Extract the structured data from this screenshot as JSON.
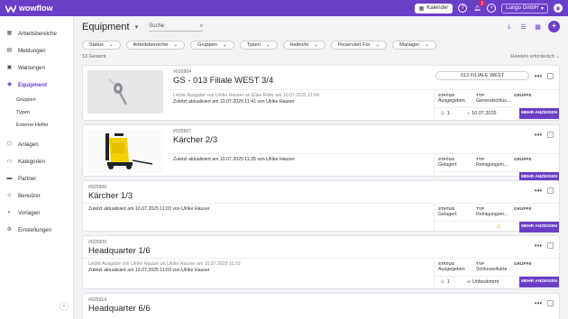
{
  "app": {
    "name": "wowflow"
  },
  "topbar": {
    "calendar_label": "Kalender",
    "notification_count": "1",
    "user_label": "Lungo GmbH"
  },
  "sidebar": {
    "items": [
      {
        "label": "Arbeitsbereiche",
        "icon": "grid-icon"
      },
      {
        "label": "Meldungen",
        "icon": "inbox-icon"
      },
      {
        "label": "Wartungen",
        "icon": "calendar-icon"
      },
      {
        "label": "Equipment",
        "icon": "equipment-icon",
        "active": true
      },
      {
        "label": "Anlagen",
        "icon": "cube-icon"
      },
      {
        "label": "Kategorien",
        "icon": "folder-icon"
      },
      {
        "label": "Partner",
        "icon": "briefcase-icon"
      },
      {
        "label": "Benutzer",
        "icon": "user-icon"
      },
      {
        "label": "Vorlagen",
        "icon": "template-icon"
      },
      {
        "label": "Einstellungen",
        "icon": "gear-icon"
      }
    ],
    "subitems": [
      "Gruppen",
      "Typen",
      "Externe Helfer"
    ]
  },
  "header": {
    "title": "Equipment",
    "search_placeholder": "Suche"
  },
  "filters": [
    "Status",
    "Arbeitsbereiche",
    "Gruppen",
    "Typen",
    "Halter/in",
    "Reserviert Für",
    "Manager"
  ],
  "count_label": "13 Gesamt",
  "sort_label": "Handeln erforderlich",
  "labels": {
    "status": "STATUS",
    "typ": "TYP",
    "gruppe": "GRUPPE",
    "more": "MEHR ANZEIGEN"
  },
  "cards": [
    {
      "id": "#025904",
      "title": "GS - 013 Filiale WEST 3/4",
      "location": "013 FILIALE WEST",
      "note1": "Letzte Ausgabe von Ulrike Hauser an Elias Elder am 10.07.2025 11:04",
      "note2": "Zuletzt aktualisiert am 10.07.2025 11:41 von Ulrike Hauser",
      "status": "Ausgegeben",
      "typ": "Generalschlüs...",
      "gruppe": "",
      "count": "1",
      "date": "10.07.2025",
      "image": "key"
    },
    {
      "id": "#025907",
      "title": "Kärcher 2/3",
      "location": "",
      "note1": "",
      "note2": "Zuletzt aktualisiert am 10.07.2025 11:35 von Ulrike Hauser",
      "status": "Gelagert",
      "typ": "Reinigungsm...",
      "gruppe": "",
      "count": "",
      "date": "",
      "image": "washer"
    },
    {
      "id": "#025906",
      "title": "Kärcher 1/3",
      "location": "",
      "note1": "",
      "note2": "Zuletzt aktualisiert am 10.07.2025 11:03 von Ulrike Hauser",
      "status": "Gelagert",
      "typ": "Reinigungsm...",
      "gruppe": "",
      "count": "",
      "date": "",
      "image": ""
    },
    {
      "id": "#025909",
      "title": "Headquarter 1/6",
      "location": "",
      "note1": "Letzte Ausgabe von Ulrike Hauser an Ulrike Hauser am 10.07.2025 11:03",
      "note2": "Zuletzt aktualisiert am 10.07.2025 11:03 von Ulrike Hauser",
      "status": "Ausgegeben",
      "typ": "Schlüsselkarte",
      "gruppe": "",
      "count": "1",
      "date": "Unbestimmt",
      "image": ""
    },
    {
      "id": "#025914",
      "title": "Headquarter 6/6",
      "location": "",
      "note1": "",
      "note2": "",
      "status": "",
      "typ": "",
      "gruppe": "",
      "count": "",
      "date": "",
      "image": ""
    }
  ]
}
